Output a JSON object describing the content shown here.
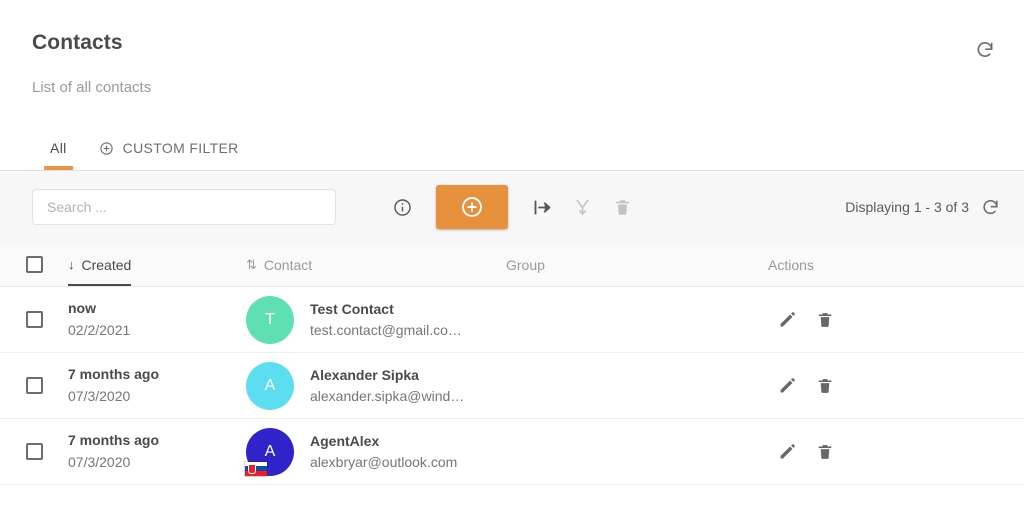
{
  "header": {
    "title": "Contacts",
    "subtitle": "List of all contacts",
    "refresh_icon": "refresh-icon"
  },
  "tabs": [
    {
      "label": "All",
      "icon": null,
      "active": true
    },
    {
      "label": "CUSTOM FILTER",
      "icon": "plus-circle-icon",
      "active": false
    }
  ],
  "toolbar": {
    "search_placeholder": "Search ...",
    "search_value": "",
    "info_icon": "info-circle-icon",
    "add_icon": "plus-circle-icon",
    "export_icon": "export-arrow-icon",
    "merge_icon": "merge-icon",
    "delete_icon": "trash-icon",
    "pagination_text": "Displaying 1 - 3 of 3",
    "refresh_icon": "refresh-icon"
  },
  "table": {
    "select_all": false,
    "columns": [
      {
        "label": "Created",
        "sort": "desc",
        "sorted": true
      },
      {
        "label": "Contact",
        "sort": "none",
        "sorted": false
      },
      {
        "label": "Group",
        "sort": null,
        "sorted": false
      },
      {
        "label": "Actions",
        "sort": null,
        "sorted": false
      }
    ],
    "rows": [
      {
        "checked": false,
        "created_relative": "now",
        "created_date": "02/2/2021",
        "avatar_letter": "T",
        "avatar_color": "#5fe0b3",
        "flag": null,
        "name": "Test Contact",
        "email": "test.contact@gmail.co…",
        "group": "",
        "edit_icon": "pencil-icon",
        "delete_icon": "trash-icon"
      },
      {
        "checked": false,
        "created_relative": "7 months ago",
        "created_date": "07/3/2020",
        "avatar_letter": "A",
        "avatar_color": "#5dddf0",
        "flag": null,
        "name": "Alexander Sipka",
        "email": "alexander.sipka@wind…",
        "group": "",
        "edit_icon": "pencil-icon",
        "delete_icon": "trash-icon"
      },
      {
        "checked": false,
        "created_relative": "7 months ago",
        "created_date": "07/3/2020",
        "avatar_letter": "A",
        "avatar_color": "#3023c9",
        "flag": "slovakia-flag-icon",
        "name": "AgentAlex",
        "email": "alexbryar@outlook.com",
        "group": "",
        "edit_icon": "pencil-icon",
        "delete_icon": "trash-icon"
      }
    ]
  },
  "colors": {
    "accent_orange": "#e8913c",
    "text_dark": "#4a4a4a",
    "text_muted": "#9a9a9a",
    "toolbar_bg": "#f7f7f7"
  }
}
